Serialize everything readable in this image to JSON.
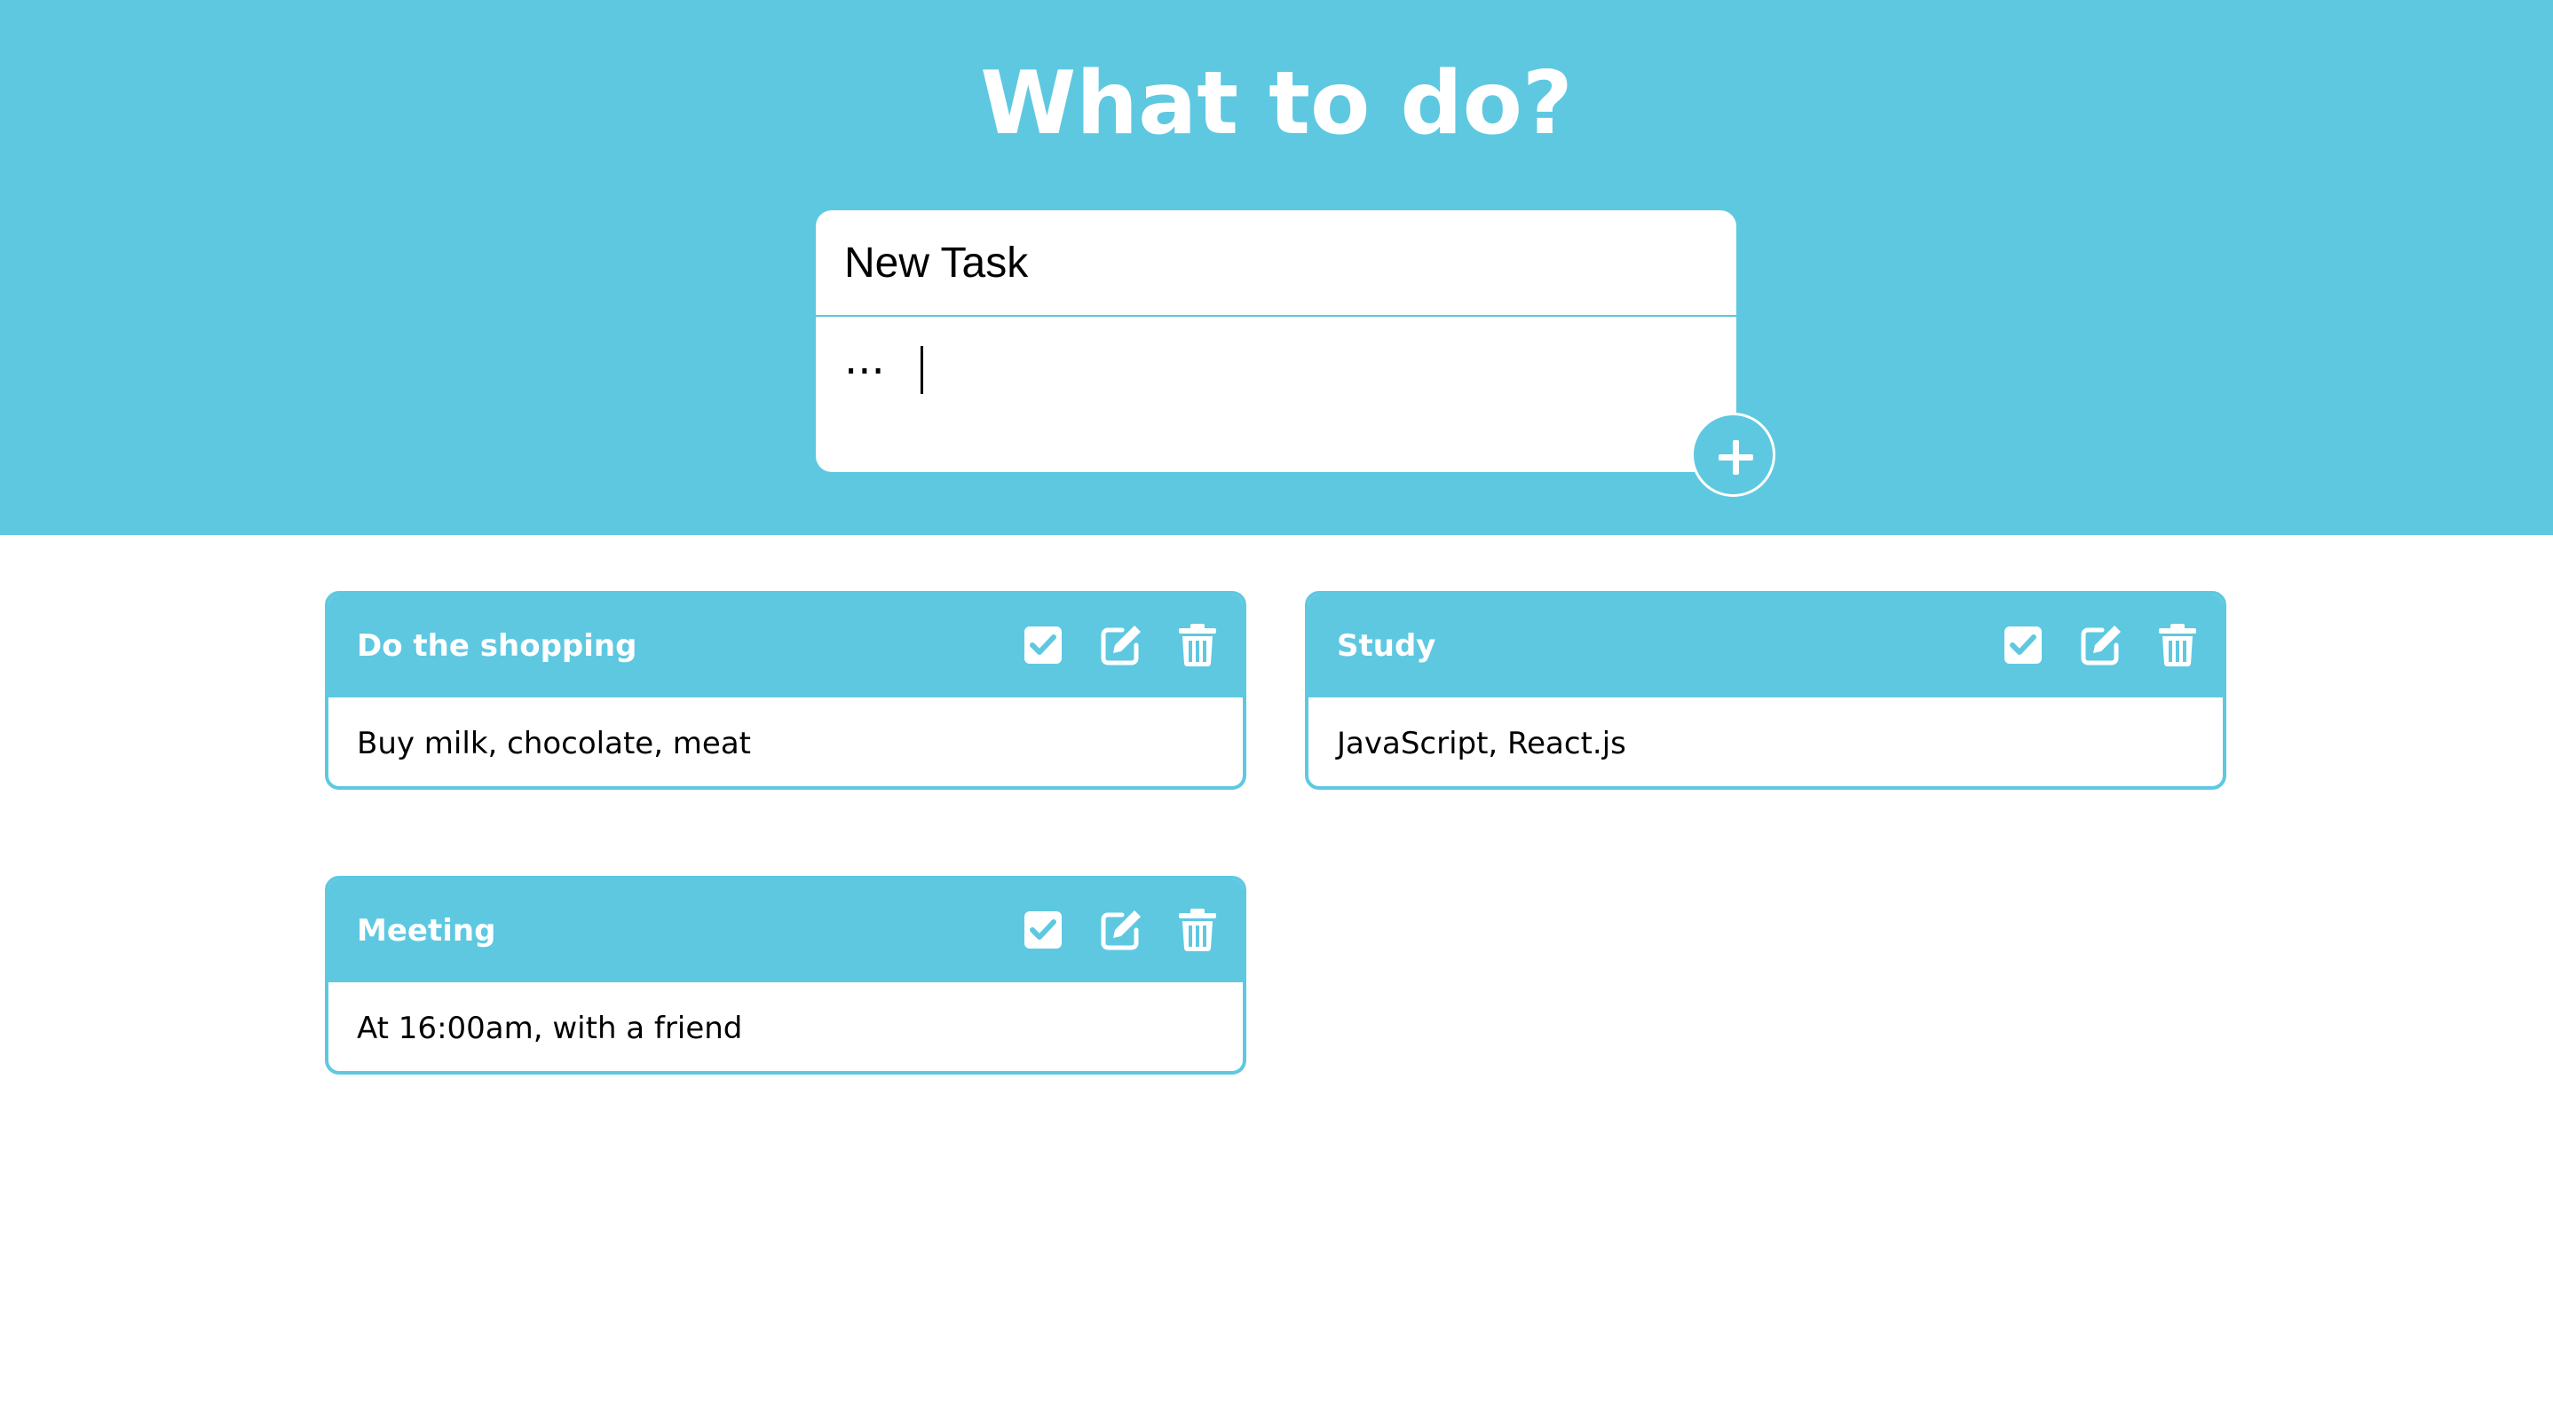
{
  "header": {
    "title": "What to do?"
  },
  "new_task_form": {
    "title_placeholder": "New Task",
    "title_value": "",
    "description_placeholder": "...",
    "description_value": "",
    "add_icon": "plus-icon"
  },
  "tasks": [
    {
      "title": "Do the shopping",
      "description": "Buy milk, chocolate, meat",
      "actions": [
        "check-square-icon",
        "edit-icon",
        "trash-icon"
      ]
    },
    {
      "title": "Study",
      "description": "JavaScript, React.js",
      "actions": [
        "check-square-icon",
        "edit-icon",
        "trash-icon"
      ]
    },
    {
      "title": "Meeting",
      "description": "At 16:00am, with a friend",
      "actions": [
        "check-square-icon",
        "edit-icon",
        "trash-icon"
      ]
    }
  ],
  "colors": {
    "accent": "#5ec8e1",
    "text": "#000000",
    "on_accent": "#ffffff"
  }
}
